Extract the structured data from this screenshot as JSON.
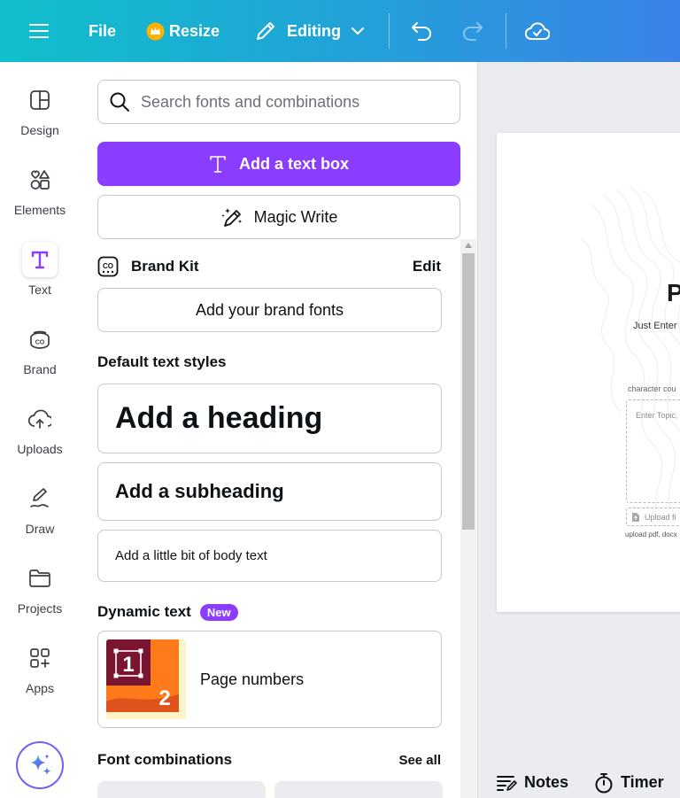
{
  "topbar": {
    "file_label": "File",
    "resize_label": "Resize",
    "editing_label": "Editing"
  },
  "rail": {
    "items": [
      {
        "label": "Design",
        "icon": "design-icon"
      },
      {
        "label": "Elements",
        "icon": "elements-icon"
      },
      {
        "label": "Text",
        "icon": "text-icon"
      },
      {
        "label": "Brand",
        "icon": "brand-icon"
      },
      {
        "label": "Uploads",
        "icon": "uploads-icon"
      },
      {
        "label": "Draw",
        "icon": "draw-icon"
      },
      {
        "label": "Projects",
        "icon": "projects-icon"
      },
      {
        "label": "Apps",
        "icon": "apps-icon"
      }
    ]
  },
  "panel": {
    "search_placeholder": "Search fonts and combinations",
    "add_text_box": "Add a text box",
    "magic_write": "Magic Write",
    "brand_kit": {
      "title": "Brand Kit",
      "edit": "Edit",
      "add_fonts": "Add your brand fonts"
    },
    "default_styles": {
      "title": "Default text styles",
      "heading": "Add a heading",
      "subheading": "Add a subheading",
      "body": "Add a little bit of body text"
    },
    "dynamic_text": {
      "title": "Dynamic text",
      "badge": "New",
      "page_numbers": "Page numbers",
      "thumb_a": "1",
      "thumb_b": "2"
    },
    "font_combinations": {
      "title": "Font combinations",
      "see_all": "See all"
    }
  },
  "canvas": {
    "big_letter": "P",
    "just_enter": "Just Enter",
    "char_count": "character cou",
    "enter_topic": "Enter Topic,",
    "upload_btn": "Upload fi",
    "upload_hint": "upload pdf, docx"
  },
  "bottom": {
    "notes": "Notes",
    "timer": "Timer"
  },
  "colors": {
    "primary": "#8b3dff",
    "topbar_start": "#10bfcc",
    "topbar_end": "#3b82e8"
  }
}
